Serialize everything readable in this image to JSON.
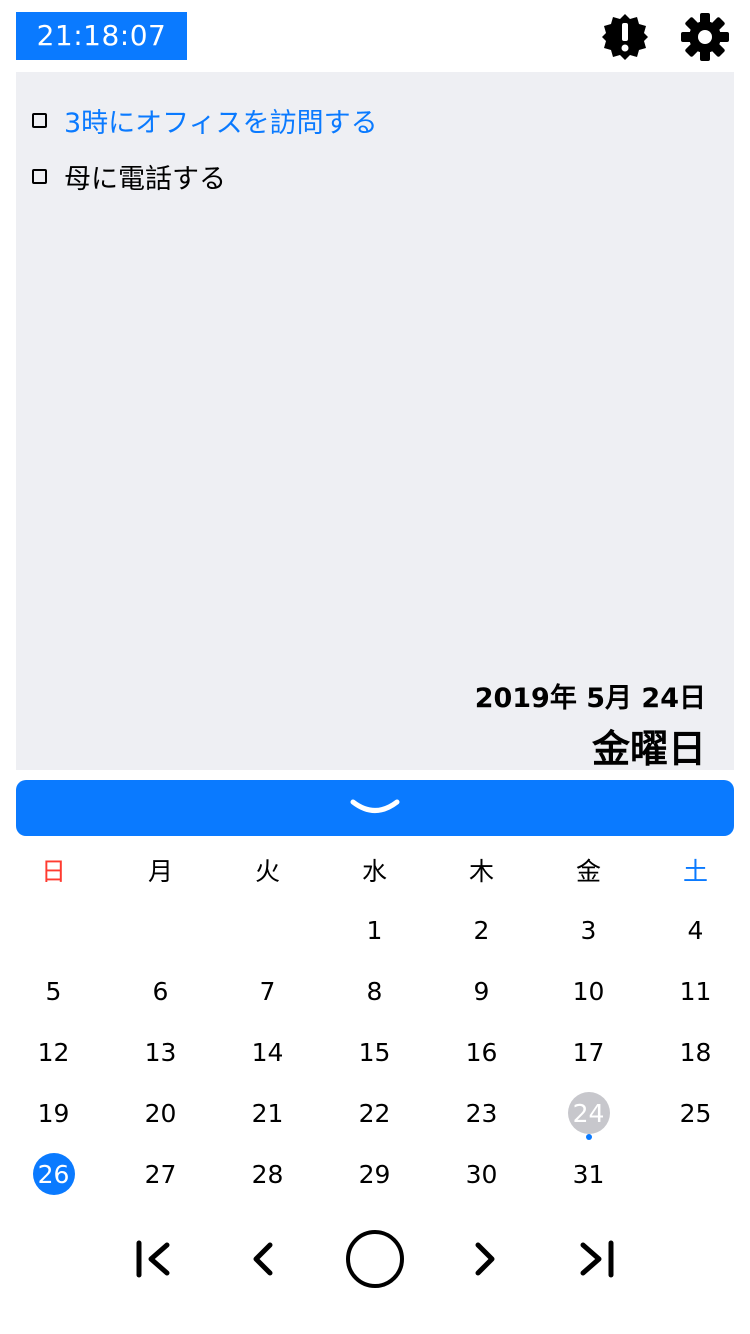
{
  "clock": {
    "time": "21:18:07"
  },
  "header": {
    "alert_icon": "alert-badge-icon",
    "settings_icon": "gear-icon"
  },
  "memo": {
    "tasks": [
      {
        "label": "3時にオフィスを訪問する",
        "checked": false,
        "color": "#0a7aff"
      },
      {
        "label": "母に電話する",
        "checked": false,
        "color": "#000000"
      }
    ],
    "date": "2019年 5月 24日",
    "weekday": "金曜日"
  },
  "collapse_bar": {
    "icon": "chevron-down-icon",
    "color": "#0a7aff"
  },
  "calendar": {
    "weekdays": [
      "日",
      "月",
      "火",
      "水",
      "木",
      "金",
      "土"
    ],
    "weeks": [
      [
        "",
        "",
        "",
        "1",
        "2",
        "3",
        "4"
      ],
      [
        "5",
        "6",
        "7",
        "8",
        "9",
        "10",
        "11"
      ],
      [
        "12",
        "13",
        "14",
        "15",
        "16",
        "17",
        "18"
      ],
      [
        "19",
        "20",
        "21",
        "22",
        "23",
        "24",
        "25"
      ],
      [
        "26",
        "27",
        "28",
        "29",
        "30",
        "31",
        ""
      ]
    ],
    "selected_day": "24",
    "today": "26",
    "event_days": [
      "24"
    ],
    "colors": {
      "sunday": "#ff3b30",
      "saturday": "#0a7aff",
      "selected": "#c7c7cc",
      "today": "#0a7aff"
    }
  },
  "navigation": {
    "buttons": [
      "first-page-icon",
      "previous-icon",
      "today-circle-icon",
      "next-icon",
      "last-page-icon"
    ]
  }
}
